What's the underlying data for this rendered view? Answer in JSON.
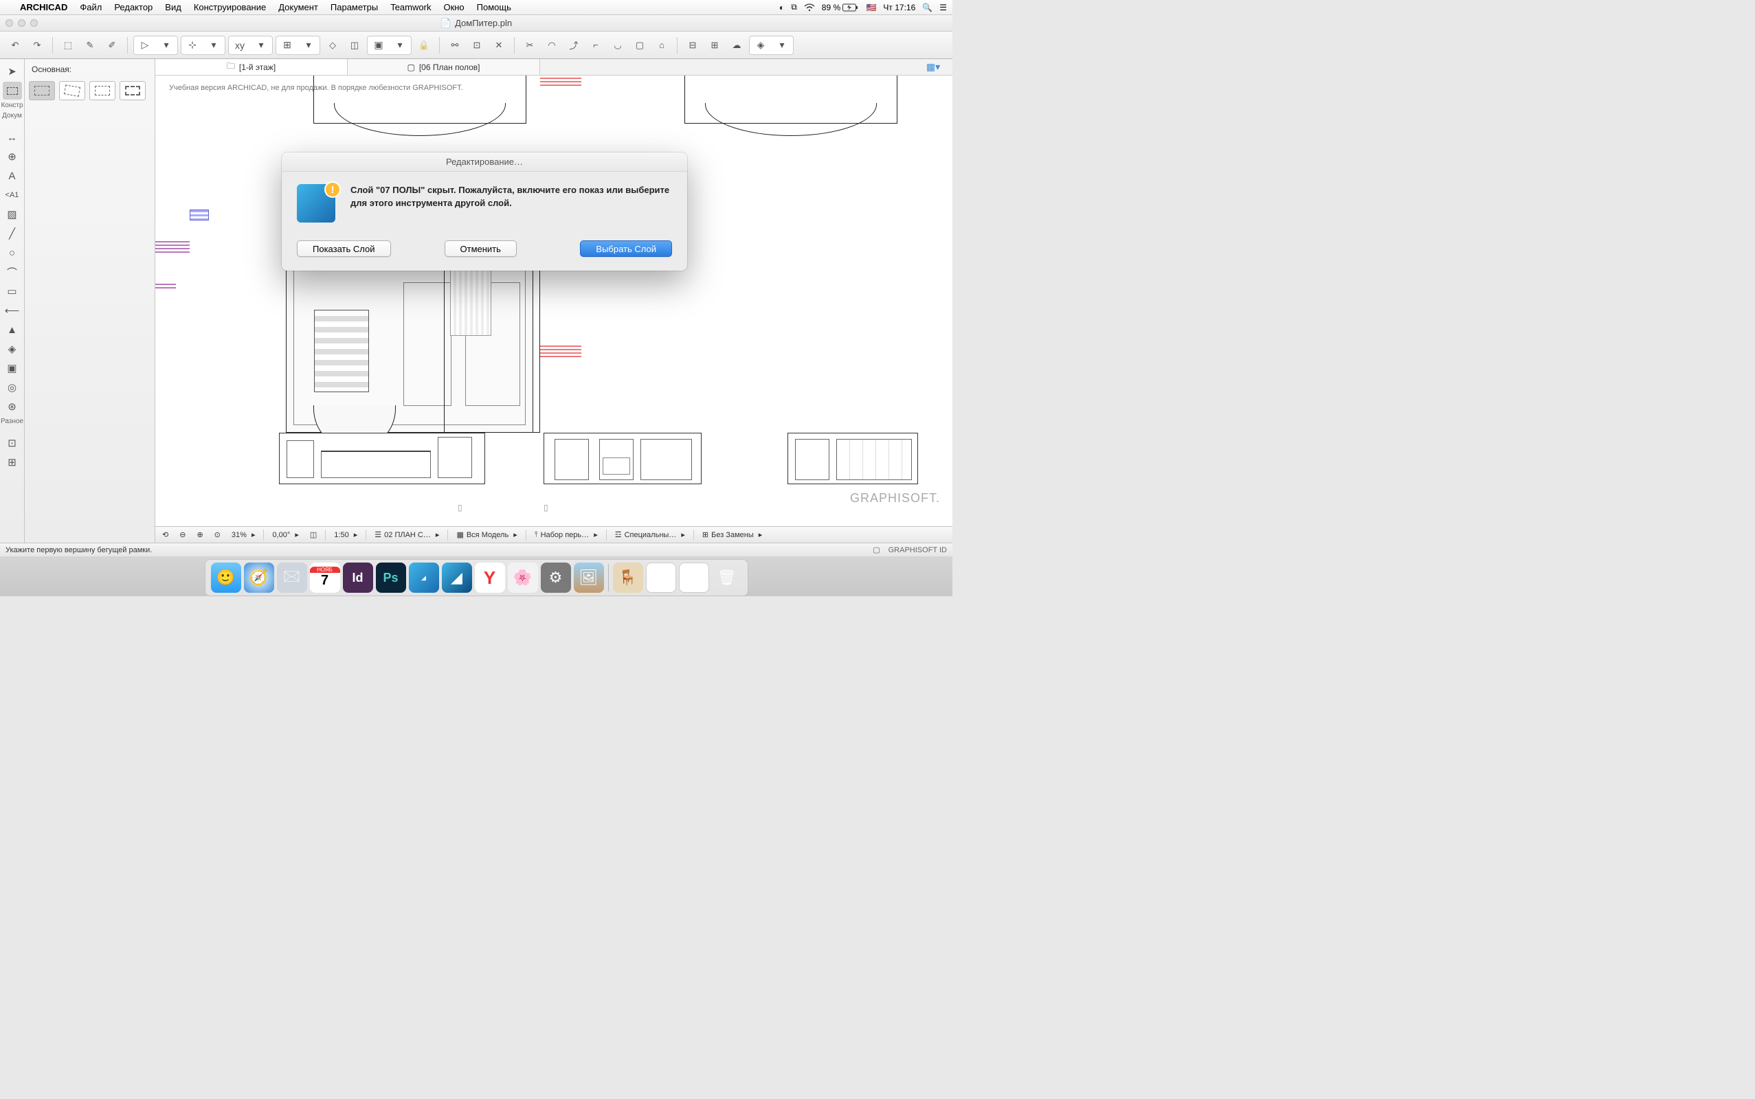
{
  "menubar": {
    "app": "ARCHICAD",
    "items": [
      "Файл",
      "Редактор",
      "Вид",
      "Конструирование",
      "Документ",
      "Параметры",
      "Teamwork",
      "Окно",
      "Помощь"
    ],
    "battery": "89 %",
    "clock": "Чт 17:16",
    "flag": "🇺🇸"
  },
  "window": {
    "title": "ДомПитер.pln"
  },
  "panel": {
    "layer_label": "Основная:",
    "side_labels": [
      "Констр",
      "Докум",
      "Разное"
    ]
  },
  "tabs": [
    {
      "icon": "folder",
      "label": "[1-й этаж]"
    },
    {
      "icon": "sheet",
      "label": "[06 План полов]"
    }
  ],
  "canvas": {
    "watermark": "Учебная версия ARCHICAD, не для продажи. В порядке любезности GRAPHISOFT.",
    "logo": "GRAPHISOFT."
  },
  "bottom": {
    "zoom": "31%",
    "angle": "0,00°",
    "scale": "1:50",
    "items": [
      "02 ПЛАН С…",
      "Вся Модель",
      "Набор перь…",
      "Специальны…",
      "Без Замены"
    ]
  },
  "status": {
    "hint": "Укажите первую вершину бегущей рамки.",
    "right": "GRAPHISOFT ID"
  },
  "dialog": {
    "title": "Редактирование…",
    "message": "Слой \"07 ПОЛЫ\" скрыт. Пожалуйста, включите его показ или выберите для этого инструмента другой слой.",
    "btn_show": "Показать Слой",
    "btn_cancel": "Отменить",
    "btn_choose": "Выбрать Слой"
  },
  "dock": {
    "items": [
      {
        "name": "finder",
        "bg": "#2a9df4"
      },
      {
        "name": "safari",
        "bg": "#3b8dd8"
      },
      {
        "name": "mail",
        "bg": "#cfd5dc"
      },
      {
        "name": "calendar",
        "bg": "#fff"
      },
      {
        "name": "indesign",
        "bg": "#4b2a56"
      },
      {
        "name": "photoshop",
        "bg": "#0a2438"
      },
      {
        "name": "archicad-edu",
        "bg": "#3fb5e8"
      },
      {
        "name": "archicad",
        "bg": "#1a6bb0"
      },
      {
        "name": "yandex",
        "bg": "#fff"
      },
      {
        "name": "photos",
        "bg": "#f2f2f2"
      },
      {
        "name": "settings",
        "bg": "#7a7a7a"
      },
      {
        "name": "preview",
        "bg": "#c79a6b"
      }
    ],
    "cal_month": "НОЯБ",
    "cal_day": "7"
  }
}
